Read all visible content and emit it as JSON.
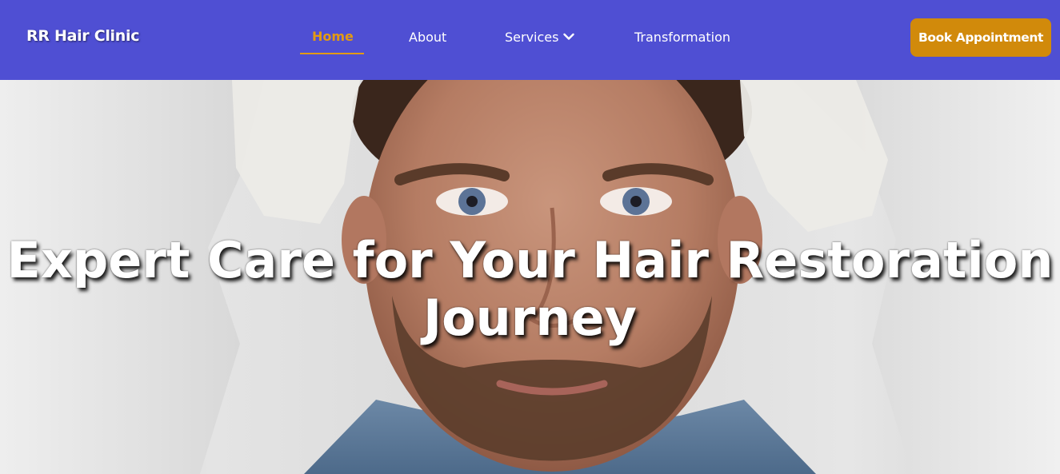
{
  "nav": {
    "brand": "RR Hair Clinic",
    "links": [
      {
        "label": "Home",
        "active": true
      },
      {
        "label": "About",
        "active": false
      },
      {
        "label": "Services",
        "active": false,
        "has_dropdown": true
      },
      {
        "label": "Transformation",
        "active": false
      }
    ],
    "cta_label": "Book Appointment"
  },
  "hero": {
    "title": "Expert Care for Your Hair Restoration Journey",
    "image_icon": "man-hair-examination-photo"
  },
  "colors": {
    "navbar_bg": "#4f4fd3",
    "active_link": "#e39a12",
    "cta_bg": "#d18a0b",
    "text": "#ffffff"
  }
}
